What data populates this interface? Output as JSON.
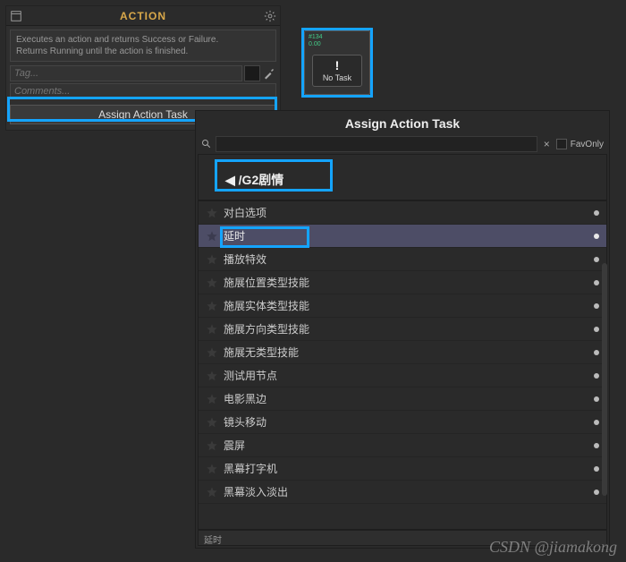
{
  "action_panel": {
    "title": "ACTION",
    "description": "Executes an action and returns Success or Failure.\nReturns Running until the action is finished.",
    "tag_placeholder": "Tag...",
    "comments_placeholder": "Comments...",
    "assign_button": "Assign Action Task"
  },
  "node": {
    "id_line": "#134",
    "time": "0.00",
    "bang": "!",
    "label": "No Task"
  },
  "assign_panel": {
    "title": "Assign Action Task",
    "clear": "×",
    "favonly": "FavOnly",
    "breadcrumb_arrow": "◀",
    "breadcrumb": "/G2剧情",
    "items": [
      {
        "label": "对白选项",
        "selected": false
      },
      {
        "label": "延时",
        "selected": true
      },
      {
        "label": "播放特效",
        "selected": false
      },
      {
        "label": "施展位置类型技能",
        "selected": false
      },
      {
        "label": "施展实体类型技能",
        "selected": false
      },
      {
        "label": "施展方向类型技能",
        "selected": false
      },
      {
        "label": "施展无类型技能",
        "selected": false
      },
      {
        "label": "测试用节点",
        "selected": false
      },
      {
        "label": "电影黑边",
        "selected": false
      },
      {
        "label": "镜头移动",
        "selected": false
      },
      {
        "label": "震屏",
        "selected": false
      },
      {
        "label": "黑幕打字机",
        "selected": false
      },
      {
        "label": "黑幕淡入淡出",
        "selected": false
      }
    ],
    "status": "延时"
  },
  "watermark": "CSDN @jiamakong"
}
